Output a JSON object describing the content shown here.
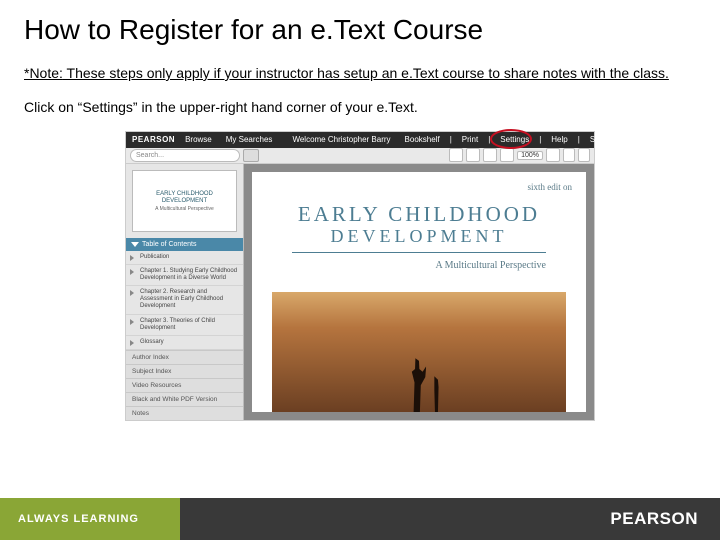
{
  "title": "How to Register for an e.Text Course",
  "note": {
    "prefix": "*Note:",
    "text": " These steps only apply if your instructor has setup an e.Text course to share notes with the class."
  },
  "instruction": "Click on “Settings” in the upper-right hand corner of your e.Text.",
  "screenshot": {
    "header": {
      "brand": "PEARSON",
      "browse": "Browse",
      "my_searches": "My Searches",
      "welcome": "Welcome Christopher Barry",
      "bookshelf": "Bookshelf",
      "print": "Print",
      "settings": "Settings",
      "help": "Help",
      "signout": "Sign Out"
    },
    "toolbar": {
      "search_placeholder": "Search...",
      "zoom": "100%"
    },
    "sidebar": {
      "thumb_title": "EARLY CHILDHOOD DEVELOPMENT",
      "thumb_sub": "A Multicultural Perspective",
      "toc_header": "Table of Contents",
      "items": [
        "Publication",
        "Chapter 1. Studying Early Childhood Development in a Diverse World",
        "Chapter 2. Research and Assessment in Early Childhood Development",
        "Chapter 3. Theories of Child Development",
        "Glossary"
      ],
      "tabs": [
        "Author Index",
        "Subject Index",
        "Video Resources",
        "Black and White PDF Version",
        "Notes"
      ]
    },
    "page": {
      "edition": "sixth edit on",
      "title_line1": "EARLY CHILDHOOD",
      "title_line2": "DEVELOPMENT",
      "subtitle": "A Multicultural Perspective"
    }
  },
  "footer": {
    "left": "ALWAYS LEARNING",
    "right": "PEARSON"
  }
}
